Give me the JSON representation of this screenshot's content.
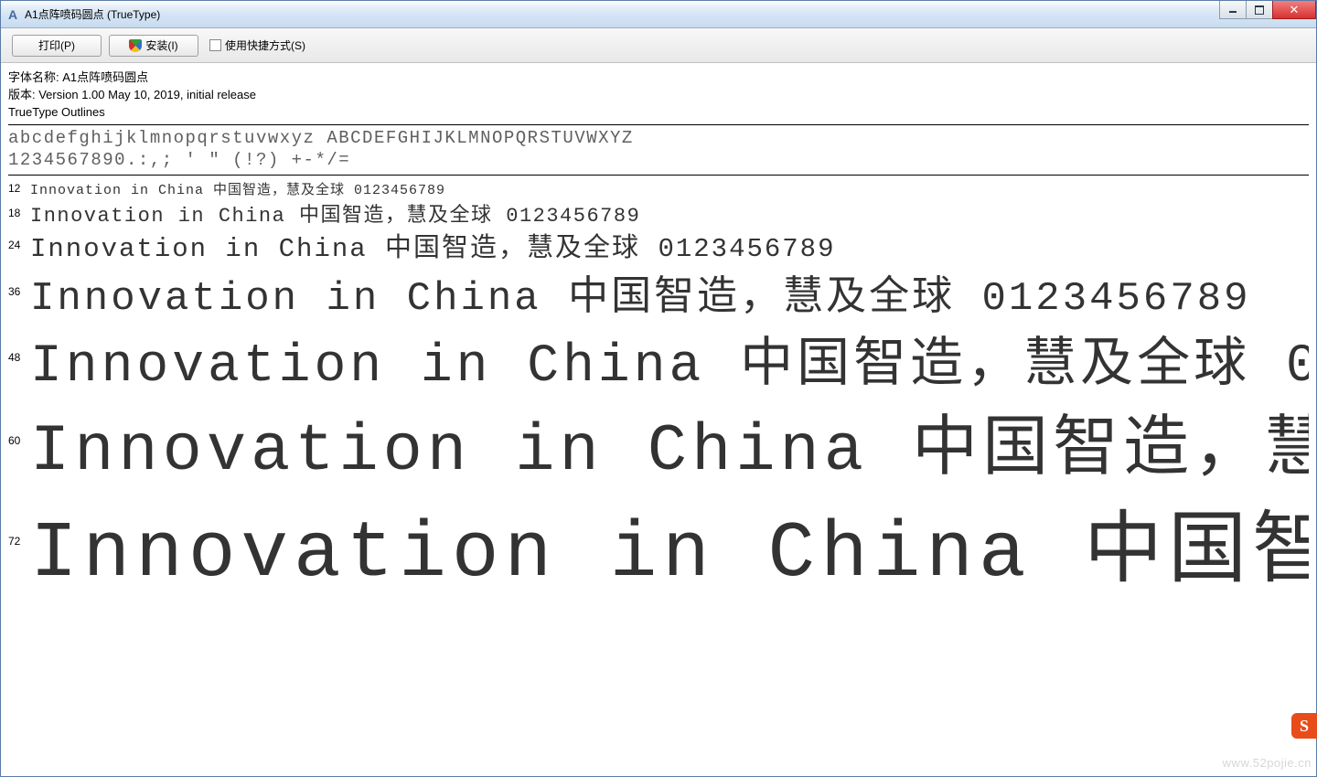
{
  "window": {
    "title": "A1点阵喷码圆点 (TrueType)",
    "icon_letter": "A"
  },
  "toolbar": {
    "print_label": "打印(P)",
    "install_label": "安装(I)",
    "shortcut_label": "使用快捷方式(S)"
  },
  "info": {
    "name_line": "字体名称: A1点阵喷码圆点",
    "version_line": "版本: Version 1.00 May 10, 2019, initial release",
    "outlines_line": "TrueType Outlines"
  },
  "charset": {
    "line1": "abcdefghijklmnopqrstuvwxyz ABCDEFGHIJKLMNOPQRSTUVWXYZ",
    "line2": "1234567890.:,; ' \" (!?) +-*/="
  },
  "specimen": {
    "sample_text": "Innovation in China 中国智造，慧及全球 0123456789",
    "rows": [
      {
        "size": "12"
      },
      {
        "size": "18"
      },
      {
        "size": "24"
      },
      {
        "size": "36"
      },
      {
        "size": "48"
      },
      {
        "size": "60"
      },
      {
        "size": "72"
      }
    ]
  },
  "overlay": {
    "badge": "S",
    "watermark": "www.52pojie.cn"
  }
}
